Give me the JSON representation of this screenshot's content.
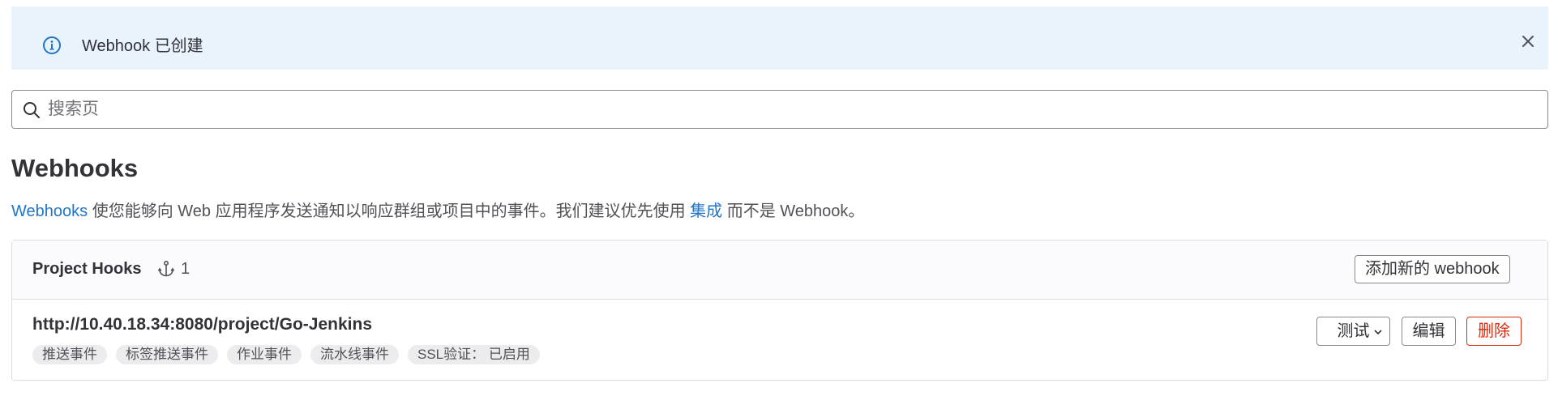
{
  "alert": {
    "message": "Webhook 已创建",
    "info_icon": "info-circle-icon",
    "close_icon": "close-icon",
    "background": "#e9f3fc",
    "icon_color": "#1f75cb"
  },
  "search": {
    "placeholder": "搜索页",
    "value": "",
    "icon": "search-icon"
  },
  "page": {
    "title": "Webhooks",
    "description": {
      "link1": "Webhooks",
      "text1": " 使您能够向 Web 应用程序发送通知以响应群组或项目中的事件。我们建议优先使用 ",
      "link2": "集成",
      "text2": " 而不是 Webhook。"
    }
  },
  "card": {
    "title": "Project Hooks",
    "count_icon": "anchor-icon",
    "count": "1",
    "add_button": "添加新的 webhook"
  },
  "hooks": [
    {
      "url": "http://10.40.18.34:8080/project/Go-Jenkins",
      "tags": [
        "推送事件",
        "标签推送事件",
        "作业事件",
        "流水线事件",
        "SSL验证： 已启用"
      ],
      "test_button": "测试",
      "edit_button": "编辑",
      "delete_button": "删除"
    }
  ],
  "colors": {
    "link": "#1f75cb",
    "danger": "#dd2b0e",
    "text": "#333238"
  }
}
